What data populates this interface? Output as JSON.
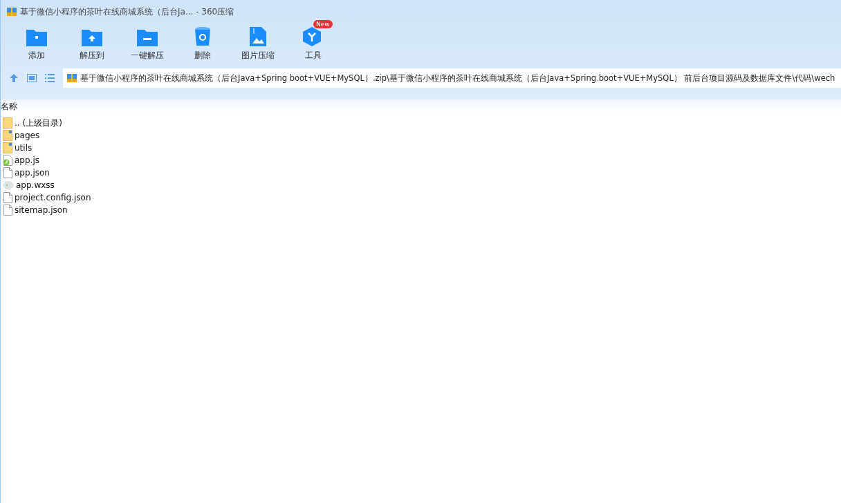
{
  "window": {
    "title": "基于微信小程序的茶叶在线商城系统（后台Ja... - 360压缩"
  },
  "toolbar": [
    {
      "label": "添加",
      "kind": "add"
    },
    {
      "label": "解压到",
      "kind": "extract"
    },
    {
      "label": "一键解压",
      "kind": "oneclick"
    },
    {
      "label": "删除",
      "kind": "delete"
    },
    {
      "label": "图片压缩",
      "kind": "image"
    },
    {
      "label": "工具",
      "kind": "tools",
      "badge": "New"
    }
  ],
  "address": {
    "path": "基于微信小程序的茶叶在线商城系统（后台Java+Spring boot+VUE+MySQL）.zip\\基于微信小程序的茶叶在线商城系统（后台Java+Spring boot+VUE+MySQL） 前后台项目源码及数据库文件\\代码\\wech"
  },
  "list": {
    "columns": [
      "名称"
    ],
    "rows": [
      {
        "name": ".. (上级目录)",
        "kind": "parent"
      },
      {
        "name": "pages",
        "kind": "folder"
      },
      {
        "name": "utils",
        "kind": "folder"
      },
      {
        "name": "app.js",
        "kind": "js"
      },
      {
        "name": "app.json",
        "kind": "file"
      },
      {
        "name": "app.wxss",
        "kind": "wxss"
      },
      {
        "name": "project.config.json",
        "kind": "file"
      },
      {
        "name": "sitemap.json",
        "kind": "file"
      }
    ]
  }
}
